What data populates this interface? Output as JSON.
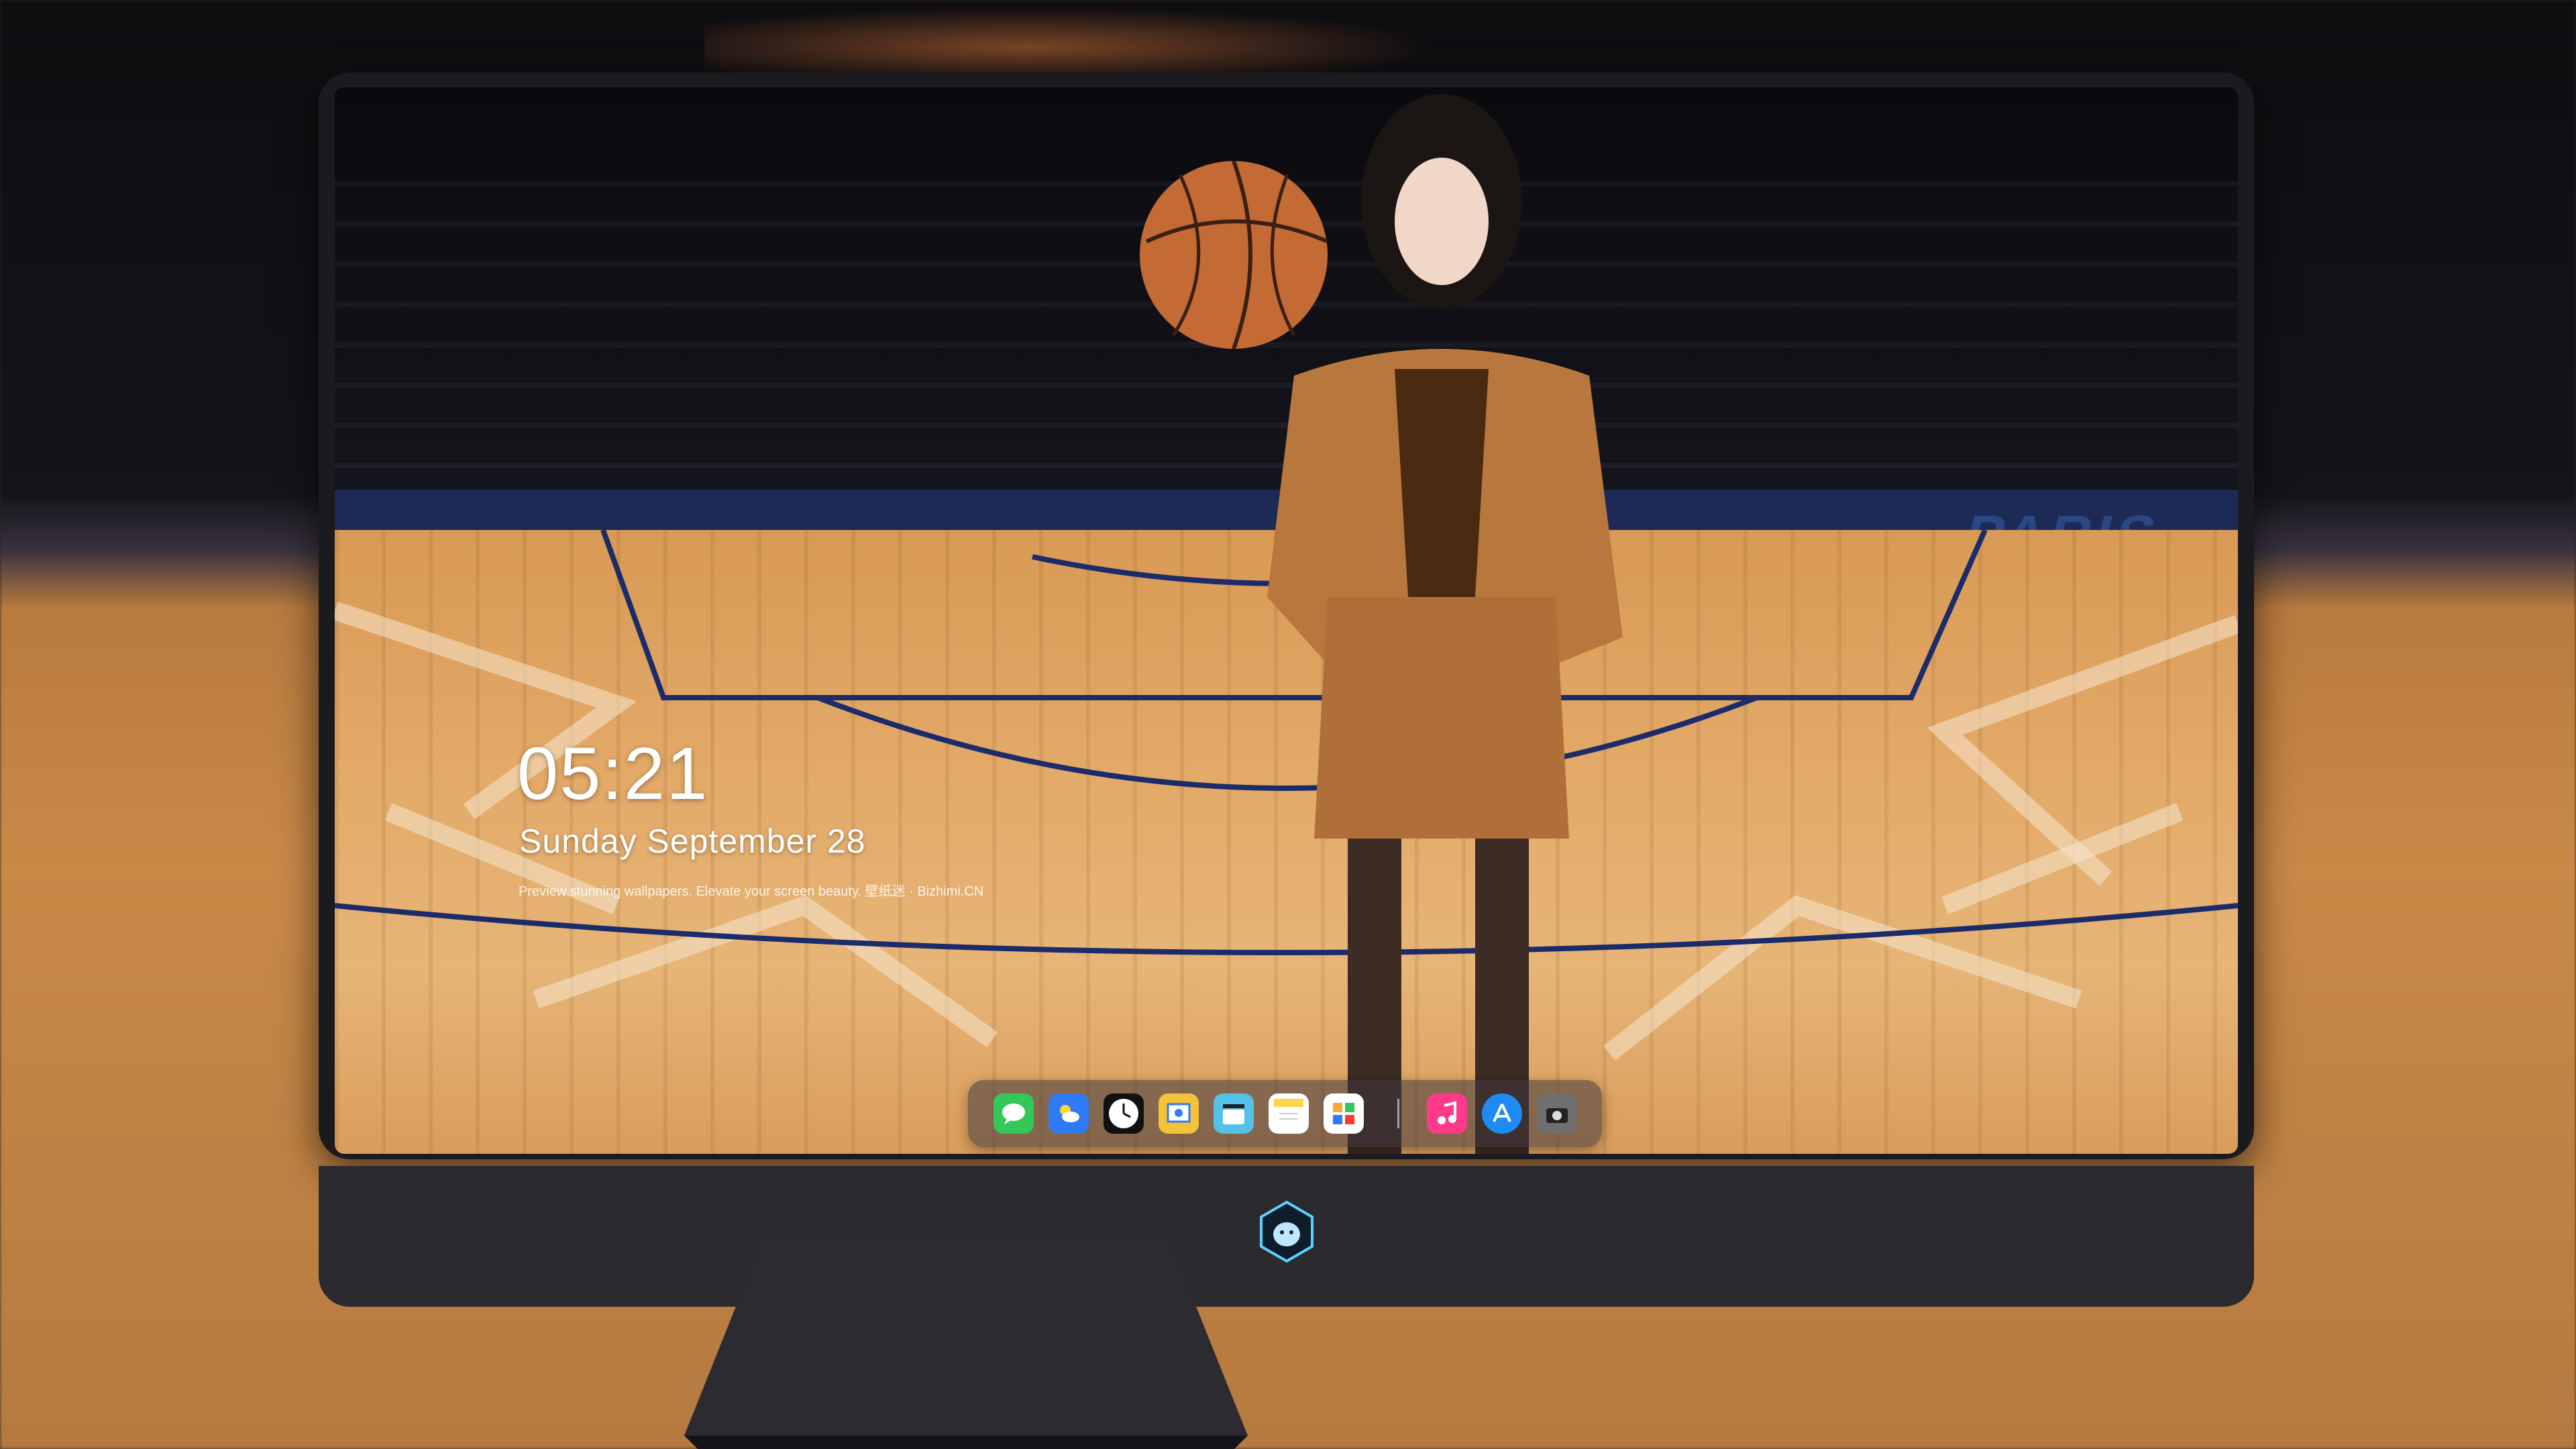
{
  "lockscreen": {
    "time": "05:21",
    "date": "Sunday September 28",
    "tagline": "Preview stunning wallpapers. Elevate your screen beauty. 壁纸迷 · Bizhimi.CN"
  },
  "court_text": "PARIS",
  "dock": {
    "apps": [
      {
        "name": "Messages",
        "icon": "messages-icon",
        "color": "#34c759"
      },
      {
        "name": "Weather",
        "icon": "weather-icon",
        "color": "#2f7bf5"
      },
      {
        "name": "Clock",
        "icon": "clock-icon",
        "color": "#ffffff"
      },
      {
        "name": "Preview",
        "icon": "preview-icon",
        "color": "#f3c33b"
      },
      {
        "name": "Clips",
        "icon": "clips-icon",
        "color": "#55c1e8"
      },
      {
        "name": "Notes",
        "icon": "notes-icon",
        "color": "#ffd54a"
      },
      {
        "name": "Photos",
        "icon": "photos-icon",
        "color": "#f7a93a"
      },
      {
        "name": "Music",
        "icon": "music-icon",
        "color": "#ff3a8a"
      },
      {
        "name": "App Store",
        "icon": "app-store-icon",
        "color": "#1e8bf5"
      },
      {
        "name": "Camera",
        "icon": "camera-icon",
        "color": "#7a7a7a"
      }
    ]
  },
  "brand": {
    "logo": "dragon-logo-icon"
  }
}
